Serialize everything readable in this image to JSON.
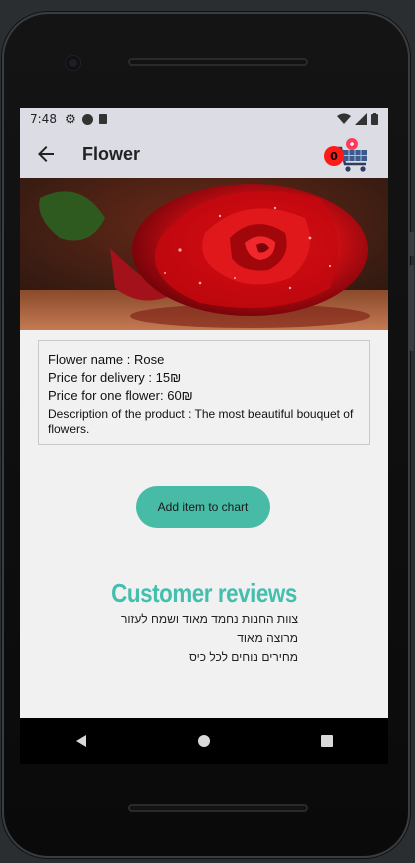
{
  "status_bar": {
    "time": "7:48"
  },
  "app_bar": {
    "title": "Flower",
    "cart_count": "0"
  },
  "product": {
    "name_line": "Flower name : Rose",
    "delivery_line": "Price for delivery : 15₪",
    "price_line": "Price for one flower: 60₪",
    "description_line": "Description of the product : The most beautiful bouquet of flowers."
  },
  "actions": {
    "add_label": "Add item to chart"
  },
  "reviews": {
    "title": "Customer reviews",
    "items": [
      "צוות החנות נחמד מאוד ושמח לעזור",
      "מרוצה מאוד",
      "מחירים נוחים לכל כיס"
    ]
  },
  "colors": {
    "accent": "#47bba6",
    "title": "#43bfae",
    "badge": "#ff1a1a",
    "appbar": "#dcdde4"
  }
}
